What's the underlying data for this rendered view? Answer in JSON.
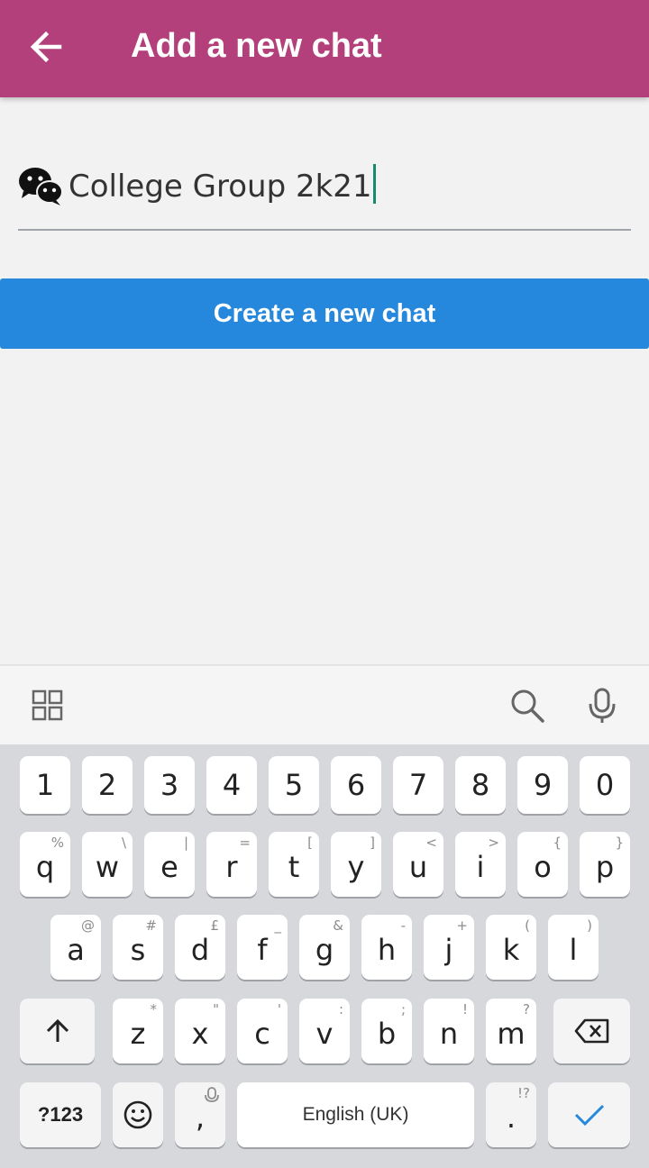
{
  "app_bar": {
    "title": "Add a new chat",
    "back_icon": "arrow-left-icon",
    "color": "#b3407b"
  },
  "form": {
    "chat_name_value": "College Group 2k21",
    "chat_icon": "wechat-icon",
    "create_button_label": "Create a new chat",
    "button_color": "#2688dc"
  },
  "keyboard": {
    "toolbar_icons": [
      "grid-menu-icon",
      "search-icon",
      "microphone-icon"
    ],
    "row_numbers": [
      "1",
      "2",
      "3",
      "4",
      "5",
      "6",
      "7",
      "8",
      "9",
      "0"
    ],
    "row_qwerty": [
      {
        "main": "q",
        "hint": "%"
      },
      {
        "main": "w",
        "hint": "\\"
      },
      {
        "main": "e",
        "hint": "|"
      },
      {
        "main": "r",
        "hint": "="
      },
      {
        "main": "t",
        "hint": "["
      },
      {
        "main": "y",
        "hint": "]"
      },
      {
        "main": "u",
        "hint": "<"
      },
      {
        "main": "i",
        "hint": ">"
      },
      {
        "main": "o",
        "hint": "{"
      },
      {
        "main": "p",
        "hint": "}"
      }
    ],
    "row_asdf": [
      {
        "main": "a",
        "hint": "@"
      },
      {
        "main": "s",
        "hint": "#"
      },
      {
        "main": "d",
        "hint": "£"
      },
      {
        "main": "f",
        "hint": "_"
      },
      {
        "main": "g",
        "hint": "&"
      },
      {
        "main": "h",
        "hint": "-"
      },
      {
        "main": "j",
        "hint": "+"
      },
      {
        "main": "k",
        "hint": "("
      },
      {
        "main": "l",
        "hint": ")"
      }
    ],
    "row_zxcv": [
      {
        "main": "z",
        "hint": "*"
      },
      {
        "main": "x",
        "hint": "\""
      },
      {
        "main": "c",
        "hint": "'"
      },
      {
        "main": "v",
        "hint": ":"
      },
      {
        "main": "b",
        "hint": ";"
      },
      {
        "main": "n",
        "hint": "!"
      },
      {
        "main": "m",
        "hint": "?"
      }
    ],
    "symbols_key": "?123",
    "comma_key": ",",
    "space_label": "English (UK)",
    "period_key": ".",
    "period_hint": "!?"
  }
}
